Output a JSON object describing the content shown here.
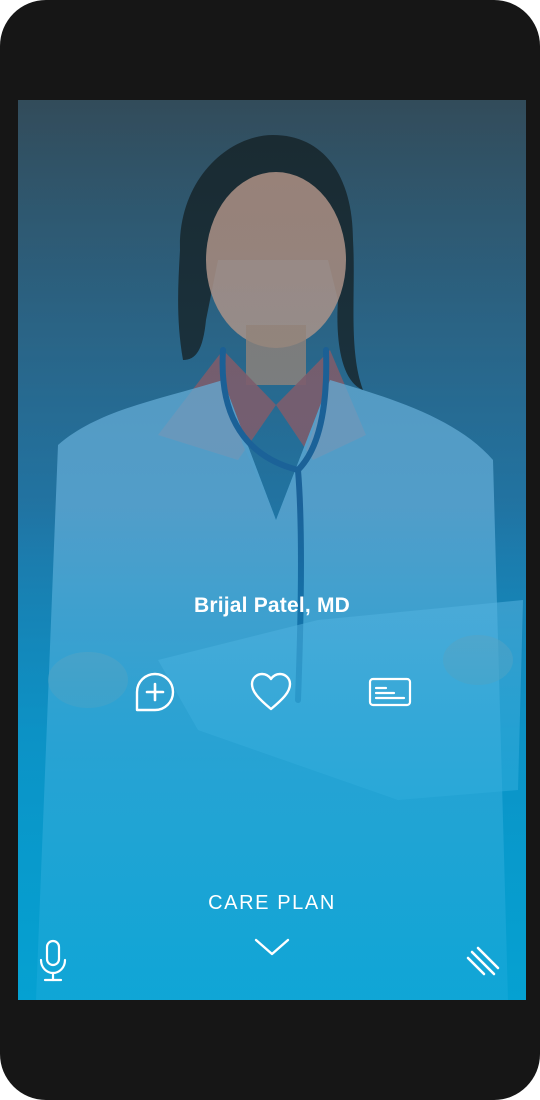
{
  "doctor": {
    "name": "Brijal Patel, MD"
  },
  "actions": [
    {
      "icon": "chat-plus-icon"
    },
    {
      "icon": "heart-icon"
    },
    {
      "icon": "id-card-icon"
    }
  ],
  "care_plan": {
    "label": "CARE PLAN",
    "icon": "chevron-down-icon"
  },
  "bottom_bar": {
    "left_icon": "microphone-icon",
    "right_icon": "menu-lines-icon"
  },
  "colors": {
    "gradient_top": "#3a4a52",
    "gradient_bottom": "#03a7d8",
    "text": "#ffffff",
    "device_frame": "#161616"
  }
}
